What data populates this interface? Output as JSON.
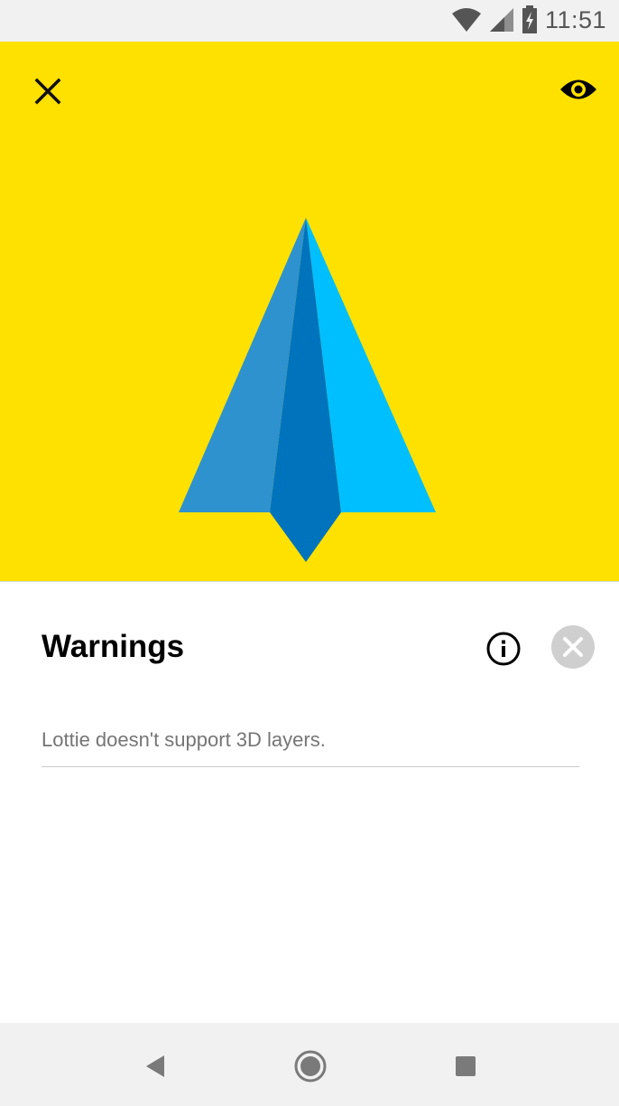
{
  "status_bar": {
    "time": "11:51",
    "icons": [
      "wifi-icon",
      "cellular-signal-icon",
      "battery-charging-icon"
    ]
  },
  "player": {
    "background_color": "#FFE100",
    "close_icon": "close-icon",
    "visibility_icon": "eye-icon",
    "animation_colors": [
      "#2E92CE",
      "#0073BD",
      "#00BFFF"
    ]
  },
  "warnings_sheet": {
    "title": "Warnings",
    "info_icon": "info-icon",
    "dismiss_icon": "close-circle-icon",
    "items": [
      {
        "text": "Lottie doesn't support 3D layers."
      }
    ]
  },
  "nav_bar": {
    "buttons": [
      "back-icon",
      "home-icon",
      "recents-icon"
    ]
  }
}
